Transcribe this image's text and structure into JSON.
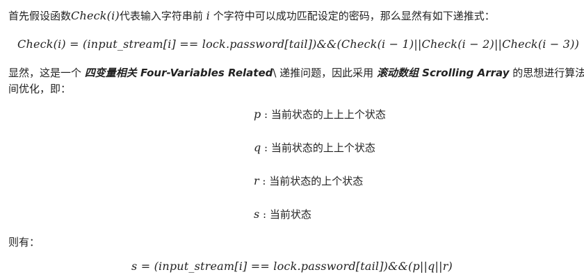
{
  "intro": {
    "pre": "首先假设函数",
    "func": "Check(i)",
    "mid": "代表输入字符串前 ",
    "var_i": "i",
    "post": " 个字符中可以成功匹配设定的密码，那么显然有如下递推式："
  },
  "recurrence1": "Check(i) = (input_stream[i] == lock.password[tail])&&(Check(i − 1)||Check(i − 2)||Check(i − 3))",
  "para2": {
    "pre": "显然，这是一个 ",
    "term1": "四变量相关 Four-Variables Related",
    "mid": "\\ 递推问题，因此采用 ",
    "term2": "滚动数组 Scrolling Array",
    "post": " 的思想进行算法空",
    "line2": "间优化，即："
  },
  "definitions": [
    {
      "var": "p",
      "sep": " : ",
      "desc": "当前状态的上上上个状态"
    },
    {
      "var": "q",
      "sep": " : ",
      "desc": "当前状态的上上个状态"
    },
    {
      "var": "r",
      "sep": " : ",
      "desc": "当前状态的上个状态"
    },
    {
      "var": "s",
      "sep": " : ",
      "desc": "当前状态"
    }
  ],
  "then_label": "则有：",
  "recurrence2": "s = (input_stream[i] == lock.password[tail])&&(p||q||r)"
}
